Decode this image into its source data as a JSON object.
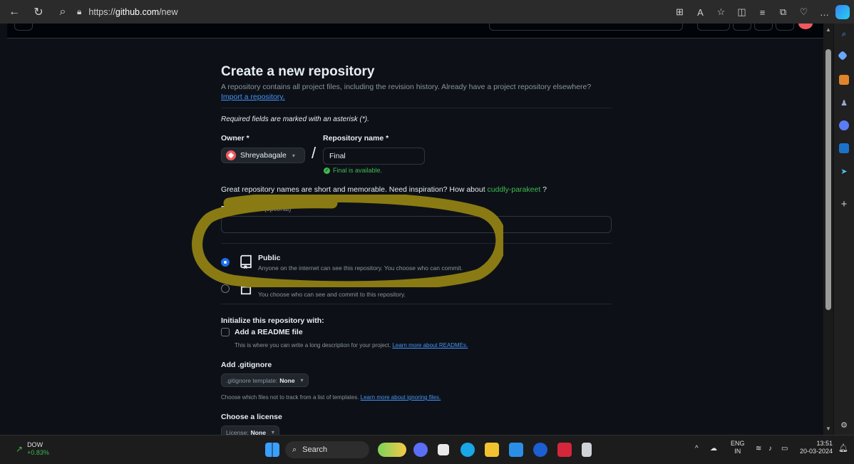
{
  "browser": {
    "url_prefix": "https://",
    "url_domain": "github.com",
    "url_path": "/new"
  },
  "form": {
    "title": "Create a new repository",
    "subtitle": "A repository contains all project files, including the revision history. Already have a project repository elsewhere?",
    "import_link": "Import a repository.",
    "required_note": "Required fields are marked with an asterisk (*).",
    "owner_label": "Owner *",
    "owner_value": "Shreyabagale",
    "repo_name_label": "Repository name *",
    "repo_name_value": "Final",
    "availability": "Final is available.",
    "inspiration_text": "Great repository names are short and memorable. Need inspiration? How about",
    "suggested_name": "cuddly-parakeet",
    "inspiration_suffix": "?",
    "description_label": "Description",
    "description_optional": "(optional)",
    "description_value": "",
    "visibility": {
      "selected": "public",
      "public_title": "Public",
      "public_desc": "Anyone on the internet can see this repository. You choose who can commit.",
      "private_title": "Private",
      "private_desc": "You choose who can see and commit to this repository."
    },
    "initialize_label": "Initialize this repository with:",
    "readme_label": "Add a README file",
    "readme_desc": "This is where you can write a long description for your project.",
    "readme_link": "Learn more about READMEs.",
    "gitignore_label": "Add .gitignore",
    "gitignore_select_prefix": ".gitignore template:",
    "gitignore_select_value": "None",
    "gitignore_desc": "Choose which files not to track from a list of templates.",
    "gitignore_link": "Learn more about ignoring files.",
    "license_label": "Choose a license",
    "license_select_prefix": "License:",
    "license_select_value": "None"
  },
  "taskbar": {
    "stock_name": "DOW",
    "stock_change": "+0.83%",
    "search_label": "Search",
    "lang": "ENG",
    "region": "IN",
    "time": "13:51",
    "date": "20-03-2024"
  },
  "colors": {
    "accent": "#1f6feb",
    "success": "#3fb950",
    "link": "#4493f8",
    "highlight": "#8a7a13"
  }
}
